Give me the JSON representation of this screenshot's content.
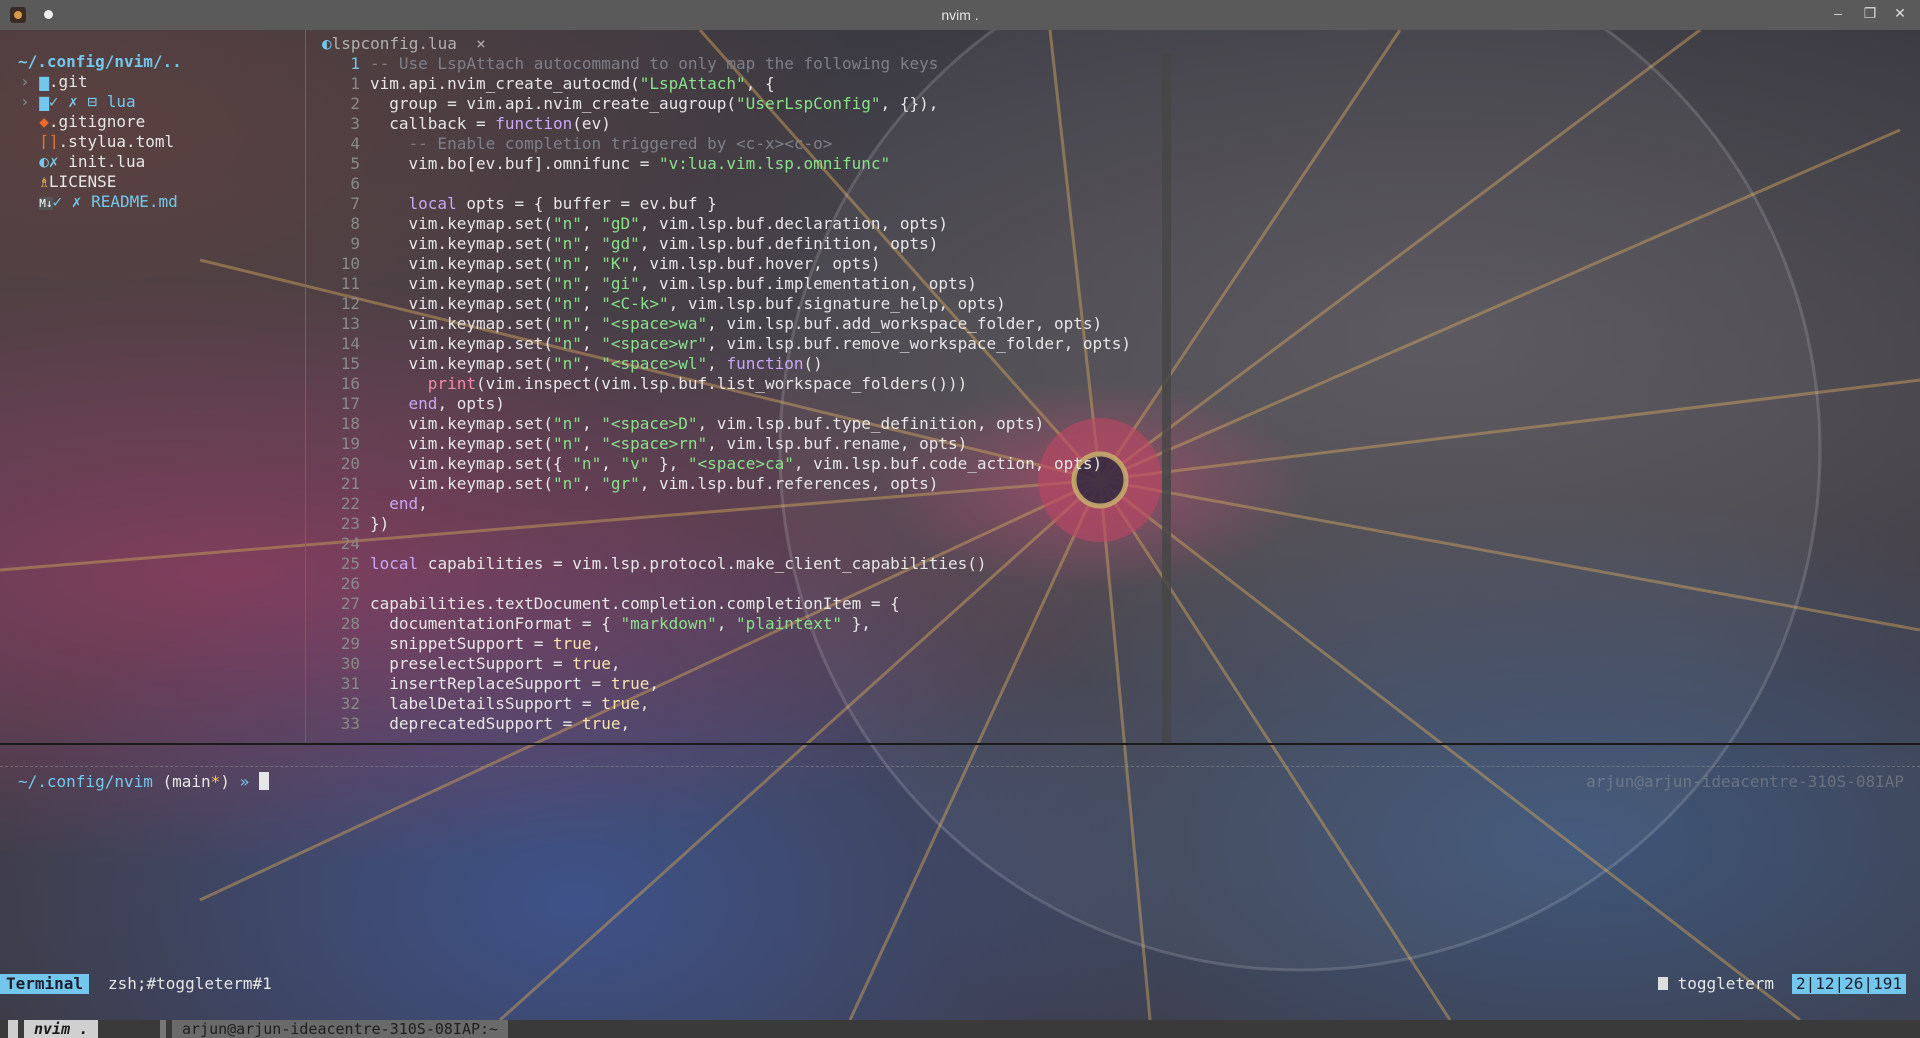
{
  "window": {
    "title": "nvim .",
    "min_glyph": "–",
    "max_glyph": "❐",
    "close_glyph": "✕"
  },
  "tree": {
    "header": "~/.config/nvim/..",
    "items": [
      {
        "arrow": "›",
        "icon": "▆",
        "flags": "",
        "name": ".git"
      },
      {
        "arrow": "›",
        "icon": "▆",
        "flags": "✓ ✗ ⊟",
        "name": "lua"
      },
      {
        "arrow": " ",
        "icon": "◆",
        "flags": "",
        "name": ".gitignore"
      },
      {
        "arrow": " ",
        "icon": "⌈⌉",
        "flags": "",
        "name": ".stylua.toml"
      },
      {
        "arrow": " ",
        "icon": "◐",
        "flags": "✗",
        "name": "init.lua"
      },
      {
        "arrow": " ",
        "icon": "♗",
        "flags": "",
        "name": "LICENSE"
      },
      {
        "arrow": " ",
        "icon": "M↓",
        "flags": "✓ ✗",
        "name": "README.md"
      }
    ]
  },
  "tab": {
    "icon": "◐",
    "label": "lspconfig.lua",
    "close": "×"
  },
  "code": {
    "first_line": {
      "num": "1",
      "text": "-- Use LspAttach autocommand to only map the following keys"
    },
    "lines": [
      {
        "num": "1",
        "parts": [
          [
            "",
            "vim.api.nvim_create_autocmd("
          ],
          [
            "c-str",
            "\"LspAttach\""
          ],
          [
            "",
            ", {"
          ]
        ]
      },
      {
        "num": "2",
        "parts": [
          [
            "",
            "  group = vim.api.nvim_create_augroup("
          ],
          [
            "c-str",
            "\"UserLspConfig\""
          ],
          [
            "",
            ", {}),"
          ]
        ]
      },
      {
        "num": "3",
        "parts": [
          [
            "",
            "  callback = "
          ],
          [
            "c-kw",
            "function"
          ],
          [
            "",
            "(ev)"
          ]
        ]
      },
      {
        "num": "4",
        "parts": [
          [
            "c-com",
            "    -- Enable completion triggered by <c-x><c-o>"
          ]
        ]
      },
      {
        "num": "5",
        "parts": [
          [
            "",
            "    vim.bo[ev.buf].omnifunc = "
          ],
          [
            "c-str",
            "\"v:lua.vim.lsp.omnifunc\""
          ]
        ]
      },
      {
        "num": "6",
        "parts": [
          [
            "",
            ""
          ]
        ]
      },
      {
        "num": "7",
        "parts": [
          [
            "c-kw",
            "    local"
          ],
          [
            "",
            " opts = { buffer = ev.buf }"
          ]
        ]
      },
      {
        "num": "8",
        "parts": [
          [
            "",
            "    vim.keymap.set("
          ],
          [
            "c-str",
            "\"n\""
          ],
          [
            "",
            ", "
          ],
          [
            "c-str",
            "\"gD\""
          ],
          [
            "",
            ", vim.lsp.buf.declaration, opts)"
          ]
        ]
      },
      {
        "num": "9",
        "parts": [
          [
            "",
            "    vim.keymap.set("
          ],
          [
            "c-str",
            "\"n\""
          ],
          [
            "",
            ", "
          ],
          [
            "c-str",
            "\"gd\""
          ],
          [
            "",
            ", vim.lsp.buf.definition, opts)"
          ]
        ]
      },
      {
        "num": "10",
        "parts": [
          [
            "",
            "    vim.keymap.set("
          ],
          [
            "c-str",
            "\"n\""
          ],
          [
            "",
            ", "
          ],
          [
            "c-str",
            "\"K\""
          ],
          [
            "",
            ", vim.lsp.buf.hover, opts)"
          ]
        ]
      },
      {
        "num": "11",
        "parts": [
          [
            "",
            "    vim.keymap.set("
          ],
          [
            "c-str",
            "\"n\""
          ],
          [
            "",
            ", "
          ],
          [
            "c-str",
            "\"gi\""
          ],
          [
            "",
            ", vim.lsp.buf.implementation, opts)"
          ]
        ]
      },
      {
        "num": "12",
        "parts": [
          [
            "",
            "    vim.keymap.set("
          ],
          [
            "c-str",
            "\"n\""
          ],
          [
            "",
            ", "
          ],
          [
            "c-str",
            "\"<C-k>\""
          ],
          [
            "",
            ", vim.lsp.buf.signature_help, opts)"
          ]
        ]
      },
      {
        "num": "13",
        "parts": [
          [
            "",
            "    vim.keymap.set("
          ],
          [
            "c-str",
            "\"n\""
          ],
          [
            "",
            ", "
          ],
          [
            "c-str",
            "\"<space>wa\""
          ],
          [
            "",
            ", vim.lsp.buf.add_workspace_folder, opts)"
          ]
        ]
      },
      {
        "num": "14",
        "parts": [
          [
            "",
            "    vim.keymap.set("
          ],
          [
            "c-str",
            "\"n\""
          ],
          [
            "",
            ", "
          ],
          [
            "c-str",
            "\"<space>wr\""
          ],
          [
            "",
            ", vim.lsp.buf.remove_workspace_folder, opts)"
          ]
        ]
      },
      {
        "num": "15",
        "parts": [
          [
            "",
            "    vim.keymap.set("
          ],
          [
            "c-str",
            "\"n\""
          ],
          [
            "",
            ", "
          ],
          [
            "c-str",
            "\"<space>wl\""
          ],
          [
            "",
            ", "
          ],
          [
            "c-kw",
            "function"
          ],
          [
            "",
            "()"
          ]
        ]
      },
      {
        "num": "16",
        "parts": [
          [
            "c-red",
            "      print"
          ],
          [
            "",
            "(vim.inspect(vim.lsp.buf.list_workspace_folders()))"
          ]
        ]
      },
      {
        "num": "17",
        "parts": [
          [
            "c-kw",
            "    end"
          ],
          [
            "",
            ", opts)"
          ]
        ]
      },
      {
        "num": "18",
        "parts": [
          [
            "",
            "    vim.keymap.set("
          ],
          [
            "c-str",
            "\"n\""
          ],
          [
            "",
            ", "
          ],
          [
            "c-str",
            "\"<space>D\""
          ],
          [
            "",
            ", vim.lsp.buf.type_definition, opts)"
          ]
        ]
      },
      {
        "num": "19",
        "parts": [
          [
            "",
            "    vim.keymap.set("
          ],
          [
            "c-str",
            "\"n\""
          ],
          [
            "",
            ", "
          ],
          [
            "c-str",
            "\"<space>rn\""
          ],
          [
            "",
            ", vim.lsp.buf.rename, opts)"
          ]
        ]
      },
      {
        "num": "20",
        "parts": [
          [
            "",
            "    vim.keymap.set({ "
          ],
          [
            "c-str",
            "\"n\""
          ],
          [
            "",
            ", "
          ],
          [
            "c-str",
            "\"v\""
          ],
          [
            "",
            " }, "
          ],
          [
            "c-str",
            "\"<space>ca\""
          ],
          [
            "",
            ", vim.lsp.buf.code_action, opts)"
          ]
        ]
      },
      {
        "num": "21",
        "parts": [
          [
            "",
            "    vim.keymap.set("
          ],
          [
            "c-str",
            "\"n\""
          ],
          [
            "",
            ", "
          ],
          [
            "c-str",
            "\"gr\""
          ],
          [
            "",
            ", vim.lsp.buf.references, opts)"
          ]
        ]
      },
      {
        "num": "22",
        "parts": [
          [
            "c-kw",
            "  end"
          ],
          [
            "",
            ","
          ]
        ]
      },
      {
        "num": "23",
        "parts": [
          [
            "",
            "})"
          ]
        ]
      },
      {
        "num": "24",
        "parts": [
          [
            "",
            ""
          ]
        ]
      },
      {
        "num": "25",
        "parts": [
          [
            "c-kw",
            "local"
          ],
          [
            "",
            " capabilities = vim.lsp.protocol.make_client_capabilities()"
          ]
        ]
      },
      {
        "num": "26",
        "parts": [
          [
            "",
            ""
          ]
        ]
      },
      {
        "num": "27",
        "parts": [
          [
            "",
            "capabilities.textDocument.completion.completionItem = {"
          ]
        ]
      },
      {
        "num": "28",
        "parts": [
          [
            "",
            "  documentationFormat = { "
          ],
          [
            "c-str",
            "\"markdown\""
          ],
          [
            "",
            ", "
          ],
          [
            "c-str",
            "\"plaintext\""
          ],
          [
            "",
            " },"
          ]
        ]
      },
      {
        "num": "29",
        "parts": [
          [
            "",
            "  snippetSupport = "
          ],
          [
            "c-bool",
            "true"
          ],
          [
            "",
            ","
          ]
        ]
      },
      {
        "num": "30",
        "parts": [
          [
            "",
            "  preselectSupport = "
          ],
          [
            "c-bool",
            "true"
          ],
          [
            "",
            ","
          ]
        ]
      },
      {
        "num": "31",
        "parts": [
          [
            "",
            "  insertReplaceSupport = "
          ],
          [
            "c-bool",
            "true"
          ],
          [
            "",
            ","
          ]
        ]
      },
      {
        "num": "32",
        "parts": [
          [
            "",
            "  labelDetailsSupport = "
          ],
          [
            "c-bool",
            "true"
          ],
          [
            "",
            ","
          ]
        ]
      },
      {
        "num": "33",
        "parts": [
          [
            "",
            "  deprecatedSupport = "
          ],
          [
            "c-bool",
            "true"
          ],
          [
            "",
            ","
          ]
        ]
      }
    ]
  },
  "terminal": {
    "path": "~/.config/nvim",
    "branch_open": " (",
    "branch": "main",
    "dirty": "*",
    "branch_close": ")",
    "arrow": " » ",
    "right_prompt": "arjun@arjun-ideacentre-310S-08IAP"
  },
  "statusline": {
    "mode": "Terminal",
    "name": "zsh;#toggleterm#1",
    "filetype": "toggleterm",
    "position": "2|12|26|191"
  },
  "bottombar": {
    "session": "nvim .",
    "host": "arjun@arjun-ideacentre-310S-08IAP:~"
  }
}
